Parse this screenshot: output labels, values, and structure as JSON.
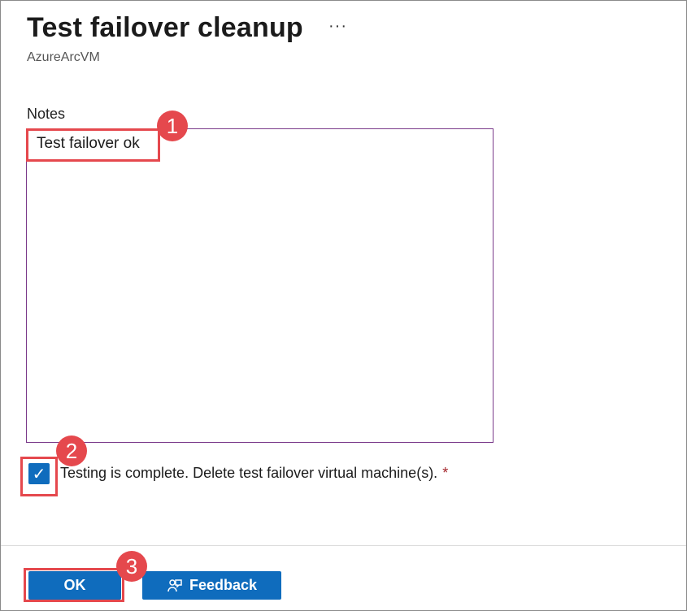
{
  "header": {
    "title": "Test failover cleanup",
    "more_icon": "ellipsis-icon",
    "more_glyph": "···",
    "subtitle": "AzureArcVM"
  },
  "notes": {
    "label": "Notes",
    "value": "Test failover ok"
  },
  "confirm": {
    "label": "Testing is complete. Delete test failover virtual machine(s).",
    "required_marker": "*",
    "checked": true,
    "check_glyph": "✓"
  },
  "footer": {
    "ok_label": "OK",
    "feedback_label": "Feedback",
    "feedback_icon": "person-feedback-icon"
  },
  "annotations": {
    "step1": "1",
    "step2": "2",
    "step3": "3",
    "color": "#e5484d"
  },
  "colors": {
    "primary": "#0f6cbd",
    "required": "#a4262c",
    "focus_border": "#7a3a8a"
  }
}
